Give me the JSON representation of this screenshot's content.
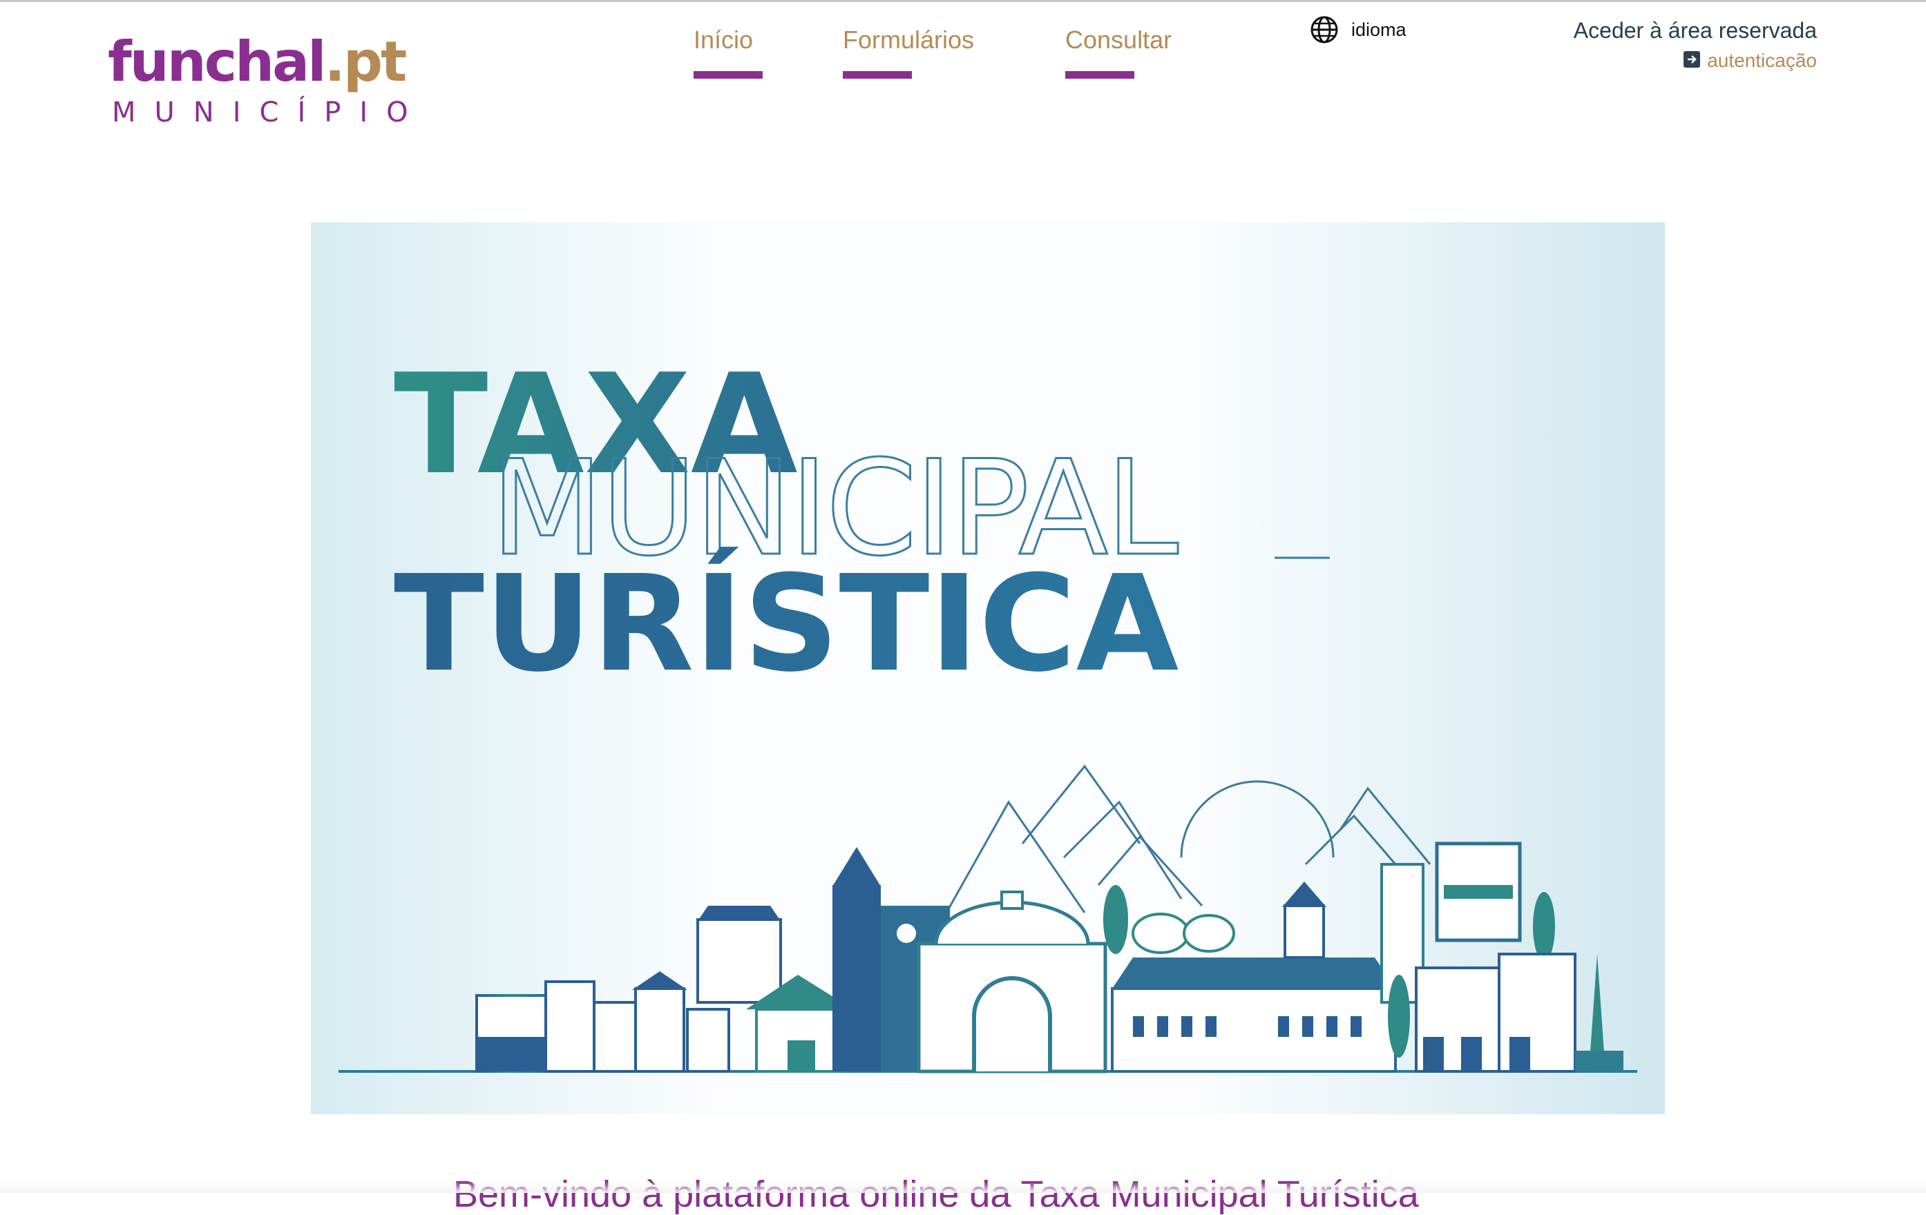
{
  "logo": {
    "name_purple": "funchal",
    "name_gold": ".pt",
    "subtitle": "MUNICÍPIO",
    "colors": {
      "purple": "#8a2f8f",
      "gold": "#b48a55"
    }
  },
  "nav": {
    "items": [
      {
        "label": "Início"
      },
      {
        "label": "Formulários"
      },
      {
        "label": "Consultar"
      }
    ],
    "accent": "#8a2f8f"
  },
  "language": {
    "icon": "globe-icon",
    "label": "idioma"
  },
  "account": {
    "title": "Aceder à área reservada",
    "auth_icon": "login-arrow-icon",
    "auth_label": "autenticação"
  },
  "banner": {
    "line1": "TAXA",
    "line2": "MUNICIPAL",
    "line3": "TURÍSTICA",
    "colors": {
      "teal": "#2f8e8a",
      "blue": "#26638f",
      "sky": "#d4ecf1"
    }
  },
  "welcome_text": "Bem-vindo à plataforma online da Taxa Municipal Turística"
}
